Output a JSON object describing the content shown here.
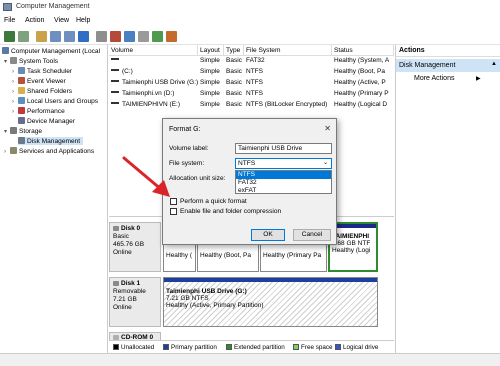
{
  "window": {
    "title": "Computer Management"
  },
  "menu": [
    "File",
    "Action",
    "View",
    "Help"
  ],
  "tree": [
    {
      "label": "Computer Management (Local",
      "depth": 0,
      "expander": "",
      "icon": "computer-icon"
    },
    {
      "label": "System Tools",
      "depth": 1,
      "expander": "▾",
      "icon": "tools-icon"
    },
    {
      "label": "Task Scheduler",
      "depth": 2,
      "expander": "›",
      "icon": "clock-icon"
    },
    {
      "label": "Event Viewer",
      "depth": 2,
      "expander": "›",
      "icon": "log-icon"
    },
    {
      "label": "Shared Folders",
      "depth": 2,
      "expander": "›",
      "icon": "folder-icon"
    },
    {
      "label": "Local Users and Groups",
      "depth": 2,
      "expander": "›",
      "icon": "users-icon"
    },
    {
      "label": "Performance",
      "depth": 2,
      "expander": "›",
      "icon": "performance-icon"
    },
    {
      "label": "Device Manager",
      "depth": 2,
      "expander": "",
      "icon": "device-icon"
    },
    {
      "label": "Storage",
      "depth": 1,
      "expander": "▾",
      "icon": "storage-icon"
    },
    {
      "label": "Disk Management",
      "depth": 2,
      "expander": "",
      "icon": "disk-icon",
      "selected": true
    },
    {
      "label": "Services and Applications",
      "depth": 1,
      "expander": "›",
      "icon": "services-icon"
    }
  ],
  "volumes": {
    "headers": [
      "Volume",
      "Layout",
      "Type",
      "File System",
      "Status"
    ],
    "rows": [
      [
        "",
        "Simple",
        "Basic",
        "FAT32",
        "Healthy (System, A"
      ],
      [
        "(C:)",
        "Simple",
        "Basic",
        "NTFS",
        "Healthy (Boot, Pa"
      ],
      [
        "Taimienphi USB Drive (G:)",
        "Simple",
        "Basic",
        "NTFS",
        "Healthy (Active, P"
      ],
      [
        "Taimienphi.vn (D:)",
        "Simple",
        "Basic",
        "NTFS",
        "Healthy (Primary P"
      ],
      [
        "TAIMIENPHIVN (E:)",
        "Simple",
        "Basic",
        "NTFS (BitLocker Encrypted)",
        "Healthy (Logical D"
      ]
    ]
  },
  "actions": {
    "header": "Actions",
    "section": "Disk Management",
    "more": "More Actions"
  },
  "disks": [
    {
      "name": "Disk 0",
      "type": "Basic",
      "size": "465.76 GB",
      "state": "Online",
      "partitions": [
        {
          "label": "Healthy (",
          "kind": "primary"
        },
        {
          "label": "Healthy (Boot, Pa",
          "kind": "primary"
        },
        {
          "label": "Healthy (Primary Pa",
          "kind": "primary"
        },
        {
          "name": "TAIMIENPHI",
          "size": "9.68 GB NTF",
          "label": "Healthy (Logi",
          "kind": "logical"
        }
      ]
    },
    {
      "name": "Disk 1",
      "type": "Removable",
      "size": "7.21 GB",
      "state": "Online",
      "partitions": [
        {
          "name": "Taimienphi USB Drive  (G:)",
          "size": "7.21 GB NTFS",
          "label": "Healthy (Active, Primary Partition)",
          "kind": "primary"
        }
      ]
    },
    {
      "name": "CD-ROM 0",
      "type": "",
      "size": "",
      "state": "",
      "partitions": []
    }
  ],
  "legend": [
    {
      "label": "Unallocated",
      "color": "#000000"
    },
    {
      "label": "Primary partition",
      "color": "#1e3f9e"
    },
    {
      "label": "Extended partition",
      "color": "#2e8b2e"
    },
    {
      "label": "Free space",
      "color": "#7fd35a"
    },
    {
      "label": "Logical drive",
      "color": "#3a52c8"
    }
  ],
  "dialog": {
    "title": "Format G:",
    "close": "✕",
    "volume_label": "Volume label:",
    "volume_value": "Taimienphi USB Drive",
    "fs_label": "File system:",
    "fs_value": "NTFS",
    "fs_options": [
      "NTFS",
      "FAT32",
      "exFAT"
    ],
    "alloc_label": "Allocation unit size:",
    "quick_format": "Perform a quick format",
    "compression": "Enable file and folder compression",
    "ok": "OK",
    "cancel": "Cancel"
  },
  "colors": {
    "accent": "#0078d7",
    "selection": "#cfe3f7",
    "arrow": "#d9252a"
  }
}
